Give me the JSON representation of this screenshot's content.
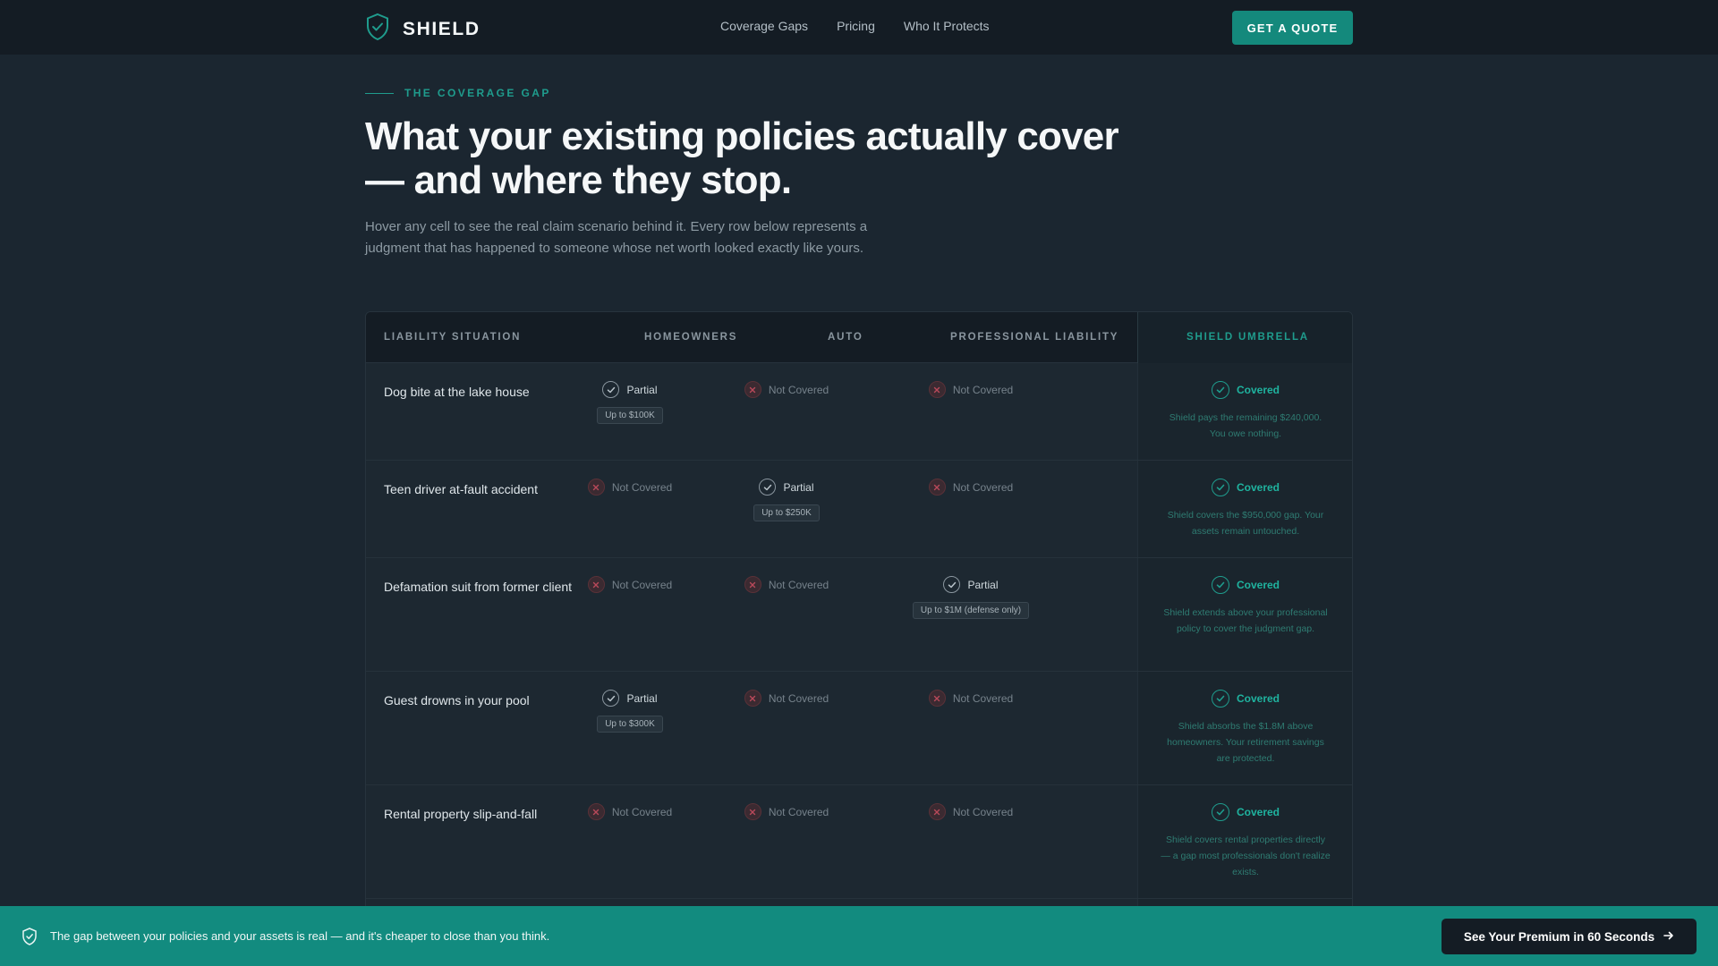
{
  "nav": {
    "brand": "SHIELD",
    "links": [
      "Coverage Gaps",
      "Pricing",
      "Who It Protects"
    ],
    "cta": "GET A QUOTE"
  },
  "hero": {
    "eyebrow": "THE COVERAGE GAP",
    "headline_line1": "What your existing policies actually cover",
    "headline_line2": "— and where they stop.",
    "subhead_line1": "Hover any cell to see the real claim scenario behind it. Every row below represents a",
    "subhead_line2": "judgment that has happened to someone whose net worth looked exactly like yours."
  },
  "table": {
    "headers": [
      "LIABILITY SITUATION",
      "HOMEOWNERS",
      "AUTO",
      "PROFESSIONAL LIABILITY",
      "SHIELD UMBRELLA"
    ],
    "rows": [
      {
        "situation": "Dog bite at the lake house",
        "homeowners": {
          "status": "Partial",
          "limit": "Up to $100K"
        },
        "auto": {
          "status": "Not Covered"
        },
        "professional": {
          "status": "Not Covered"
        },
        "shield": {
          "status": "Covered",
          "note": "Shield pays the remaining $240,000. You owe nothing."
        }
      },
      {
        "situation": "Teen driver at-fault accident",
        "homeowners": {
          "status": "Not Covered"
        },
        "auto": {
          "status": "Partial",
          "limit": "Up to $250K"
        },
        "professional": {
          "status": "Not Covered"
        },
        "shield": {
          "status": "Covered",
          "note": "Shield covers the $950,000 gap. Your assets remain untouched."
        }
      },
      {
        "situation": "Defamation suit from former client",
        "homeowners": {
          "status": "Not Covered"
        },
        "auto": {
          "status": "Not Covered"
        },
        "professional": {
          "status": "Partial",
          "limit": "Up to $1M (defense only)"
        },
        "shield": {
          "status": "Covered",
          "note": "Shield extends above your professional policy to cover the judgment gap."
        }
      },
      {
        "situation": "Guest drowns in your pool",
        "homeowners": {
          "status": "Partial",
          "limit": "Up to $300K"
        },
        "auto": {
          "status": "Not Covered"
        },
        "professional": {
          "status": "Not Covered"
        },
        "shield": {
          "status": "Covered",
          "note": "Shield absorbs the $1.8M above homeowners. Your retirement savings are protected."
        }
      },
      {
        "situation": "Rental property slip-and-fall",
        "homeowners": {
          "status": "Not Covered"
        },
        "auto": {
          "status": "Not Covered"
        },
        "professional": {
          "status": "Not Covered"
        },
        "shield": {
          "status": "Covered",
          "note": "Shield covers rental properties directly — a gap most professionals don't realize exists."
        }
      }
    ]
  },
  "bottom_bar": {
    "message": "The gap between your policies and your assets is real — and it's cheaper to close than you think.",
    "cta": "See Your Premium in 60 Seconds"
  },
  "colors": {
    "accent": "#1f9c8d",
    "background": "#1b2630",
    "nav_background": "#141c24",
    "bottom_bar": "#128b7f"
  },
  "icons": [
    "shield-logo-icon",
    "check-circle-icon",
    "x-circle-icon",
    "arrow-right-icon"
  ]
}
